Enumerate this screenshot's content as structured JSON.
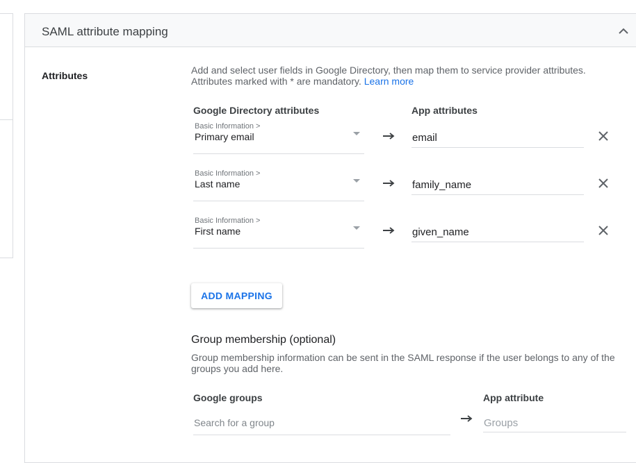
{
  "card": {
    "title": "SAML attribute mapping",
    "collapse_icon": "chevron-up-icon"
  },
  "attributes": {
    "label": "Attributes",
    "description_text": "Add and select user fields in Google Directory, then map them to service provider attributes. Attributes marked with * are mandatory. ",
    "learn_more": "Learn more",
    "col_directory": "Google Directory attributes",
    "col_app": "App attributes",
    "rows": [
      {
        "category": "Basic Information >",
        "field": "Primary email",
        "app_value": "email"
      },
      {
        "category": "Basic Information >",
        "field": "Last name",
        "app_value": "family_name"
      },
      {
        "category": "Basic Information >",
        "field": "First name",
        "app_value": "given_name"
      }
    ],
    "add_mapping_label": "ADD MAPPING"
  },
  "group": {
    "title": "Group membership (optional)",
    "description": "Group membership information can be sent in the SAML response if the user belongs to any of the groups you add here.",
    "col_groups": "Google groups",
    "col_app": "App attribute",
    "search_placeholder": "Search for a group",
    "app_placeholder": "Groups"
  },
  "colors": {
    "accent": "#1a73e8",
    "header_bg": "#f8f9fa",
    "divider": "#dadce0"
  }
}
